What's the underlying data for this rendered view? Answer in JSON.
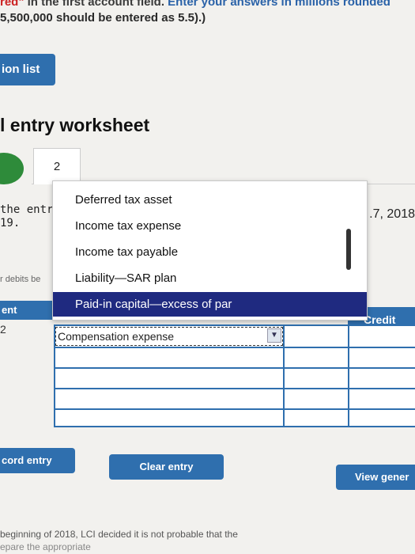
{
  "header": {
    "line1_red": "red\"",
    "line1_dark": " in the first account field. ",
    "line1_blue": "Enter your answers in millions rounded",
    "line2": "5,500,000 should be entered as 5.5).)"
  },
  "transaction_list_button": "ion list",
  "worksheet_title": "l entry worksheet",
  "tab_number": "2",
  "left_fragments": {
    "the_entry": "the entry",
    "year": "19.",
    "debits": "r debits be"
  },
  "date_fragment": ".7, 2018",
  "table": {
    "ent_header": "ent",
    "credit_header": "Credit",
    "row_number": "2",
    "selected_account": "Compensation expense"
  },
  "dropdown": {
    "items": [
      "Deferred tax asset",
      "Income tax expense",
      "Income tax payable",
      "Liability—SAR plan",
      "Paid-in capital—excess of par"
    ],
    "selected_index": 4
  },
  "buttons": {
    "record_entry": "cord entry",
    "clear_entry": "Clear entry",
    "view_general": "View gener"
  },
  "footer": {
    "line1": "beginning of 2018, LCI decided it is not probable that the",
    "line2": "epare the appropriate"
  },
  "colors": {
    "accent": "#2f6fae",
    "selection": "#1f2a80",
    "tab_green": "#2e8b3a"
  }
}
